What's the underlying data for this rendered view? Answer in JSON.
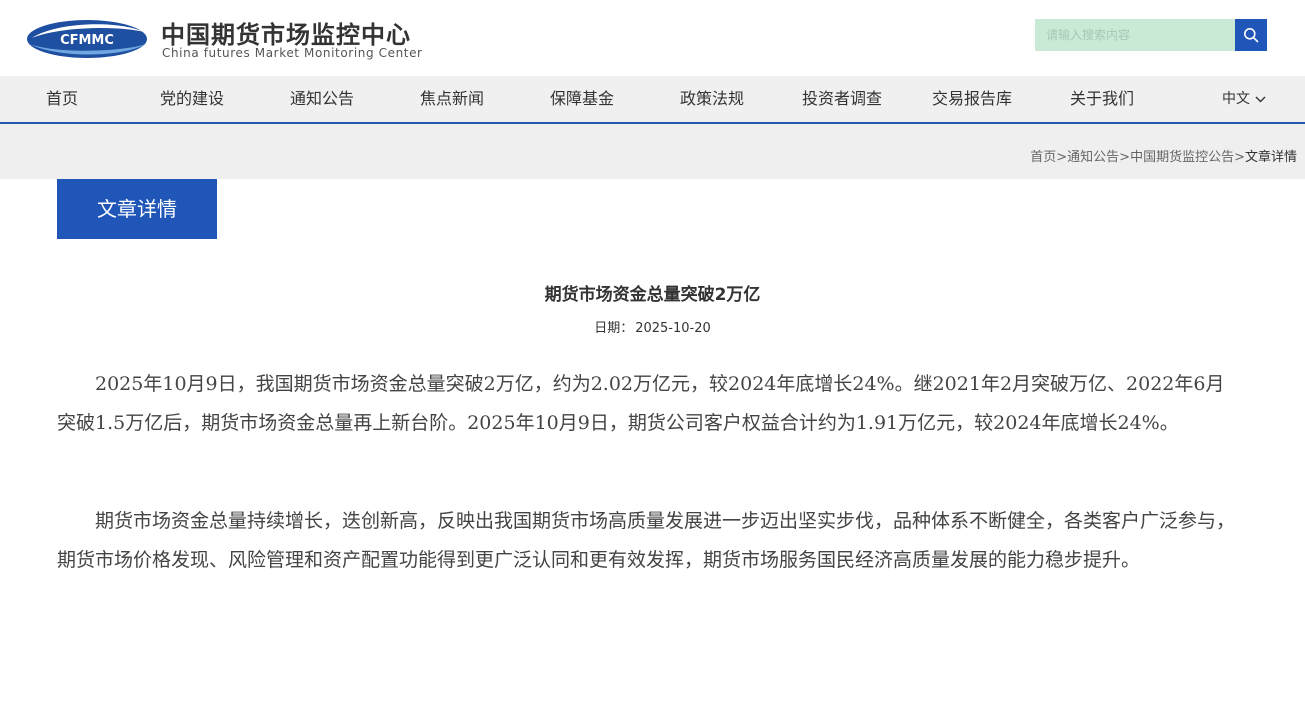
{
  "header": {
    "logo_text": "CFMMC",
    "title_cn": "中国期货市场监控中心",
    "title_en": "China futures Market Monitoring Center",
    "search_placeholder": "请输入搜索内容"
  },
  "nav": {
    "items": [
      "首页",
      "党的建设",
      "通知公告",
      "焦点新闻",
      "保障基金",
      "政策法规",
      "投资者调查",
      "交易报告库",
      "关于我们"
    ],
    "language": "中文"
  },
  "breadcrumb": {
    "items": [
      "首页",
      "通知公告",
      "中国期货监控公告"
    ],
    "separator": ">",
    "current": "文章详情"
  },
  "section_tab": "文章详情",
  "article": {
    "title": "期货市场资金总量突破2万亿",
    "date_label": "日期：",
    "date": "2025-10-20",
    "paragraphs": [
      "2025年10月9日，我国期货市场资金总量突破2万亿，约为2.02万亿元，较2024年底增长24%。继2021年2月突破万亿、2022年6月突破1.5万亿后，期货市场资金总量再上新台阶。2025年10月9日，期货公司客户权益合计约为1.91万亿元，较2024年底增长24%。",
      "期货市场资金总量持续增长，迭创新高，反映出我国期货市场高质量发展进一步迈出坚实步伐，品种体系不断健全，各类客户广泛参与，期货市场价格发现、风险管理和资产配置功能得到更广泛认同和更有效发挥，期货市场服务国民经济高质量发展的能力稳步提升。"
    ]
  },
  "colors": {
    "brand_blue": "#1f56b8",
    "nav_bg": "#f0f0f0",
    "search_bg": "#c9ead5"
  }
}
